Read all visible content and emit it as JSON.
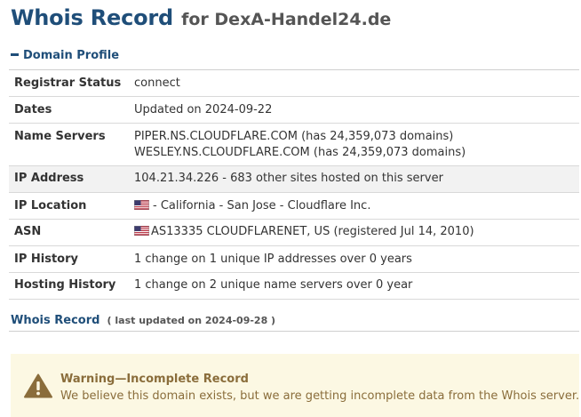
{
  "header": {
    "title": "Whois Record",
    "domain_text": "for DexA-Handel24.de"
  },
  "profile": {
    "section_title": "Domain Profile",
    "collapse_icon": "minus-icon",
    "rows": [
      {
        "label": "Registrar Status",
        "value": "connect"
      },
      {
        "label": "Dates",
        "value": "Updated on 2024-09-22"
      },
      {
        "label": "Name Servers",
        "values": [
          "PIPER.NS.CLOUDFLARE.COM (has 24,359,073 domains)",
          "WESLEY.NS.CLOUDFLARE.COM (has 24,359,073 domains)"
        ]
      },
      {
        "label": "IP Address",
        "value": "104.21.34.226 - 683 other sites hosted on this server"
      },
      {
        "label": "IP Location",
        "value": "- California - San Jose - Cloudflare Inc.",
        "icon": "us-flag-icon"
      },
      {
        "label": "ASN",
        "value": "AS13335 CLOUDFLARENET, US (registered Jul 14, 2010)",
        "icon": "us-flag-icon"
      },
      {
        "label": "IP History",
        "value": "1 change on 1 unique IP addresses over 0 years"
      },
      {
        "label": "Hosting History",
        "value": "1 change on 2 unique name servers over 0 year"
      }
    ]
  },
  "whois": {
    "link_label": "Whois Record",
    "updated_text": "( last updated on 2024-09-28 )"
  },
  "warning": {
    "icon": "warning-triangle-icon",
    "title": "Warning—Incomplete Record",
    "message": "We believe this domain exists, but we are getting incomplete data from the Whois server."
  },
  "colors": {
    "heading_blue": "#1f4e79",
    "warning_bg": "#fcf8e3",
    "warning_text": "#8a6d3b",
    "warning_icon": "#8a6d3b",
    "row_shade": "#f2f2f2"
  }
}
